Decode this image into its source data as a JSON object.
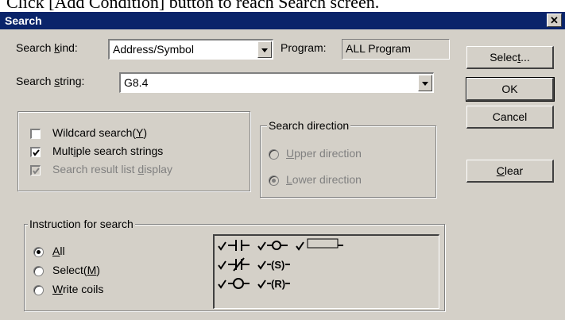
{
  "caption": "Click [Add Condition] button to reach Search screen.",
  "dialog": {
    "title": "Search",
    "close_glyph": "✕"
  },
  "search_kind": {
    "label_pre": "Search ",
    "label_key": "k",
    "label_post": "ind:",
    "value": "Address/Symbol"
  },
  "program": {
    "label": "Program:",
    "value": "ALL Program"
  },
  "search_string": {
    "label_pre": "Search ",
    "label_key": "s",
    "label_post": "tring:",
    "value": "G8.4"
  },
  "buttons": {
    "select": {
      "pre": "Selec",
      "key": "t",
      "post": "..."
    },
    "ok": "OK",
    "cancel": "Cancel",
    "clear": {
      "pre": "",
      "key": "C",
      "post": "lear"
    }
  },
  "options": {
    "wildcard": {
      "pre": "Wildcard search(",
      "key": "Y",
      "post": ")",
      "checked": false
    },
    "multiple": {
      "pre": "Mult",
      "key": "i",
      "post": "ple search strings",
      "checked": true
    },
    "result_list": {
      "pre": "Search result list ",
      "key": "d",
      "post": "isplay",
      "checked": true,
      "disabled": true
    }
  },
  "direction": {
    "title": "Search direction",
    "upper": {
      "pre": "",
      "key": "U",
      "post": "pper direction",
      "selected": false,
      "disabled": true
    },
    "lower": {
      "pre": "",
      "key": "L",
      "post": "ower direction",
      "selected": true,
      "disabled": true
    }
  },
  "instruction": {
    "title": "Instruction for search",
    "all": {
      "pre": "",
      "key": "A",
      "post": "ll",
      "selected": true
    },
    "select": {
      "pre": "Select(",
      "key": "M",
      "post": ")",
      "selected": false
    },
    "write_coils": {
      "pre": "",
      "key": "W",
      "post": "rite coils",
      "selected": false
    },
    "symbols": {
      "s_label": "(S)",
      "r_label": "(R)",
      "items": [
        "contact-no",
        "coil",
        "function-block",
        "contact-nc",
        "set-coil",
        "coil-2",
        "reset-coil"
      ]
    }
  },
  "colors": {
    "face": "#d4d0c8",
    "title_bar": "#0a246a",
    "disabled_text": "#808080"
  }
}
